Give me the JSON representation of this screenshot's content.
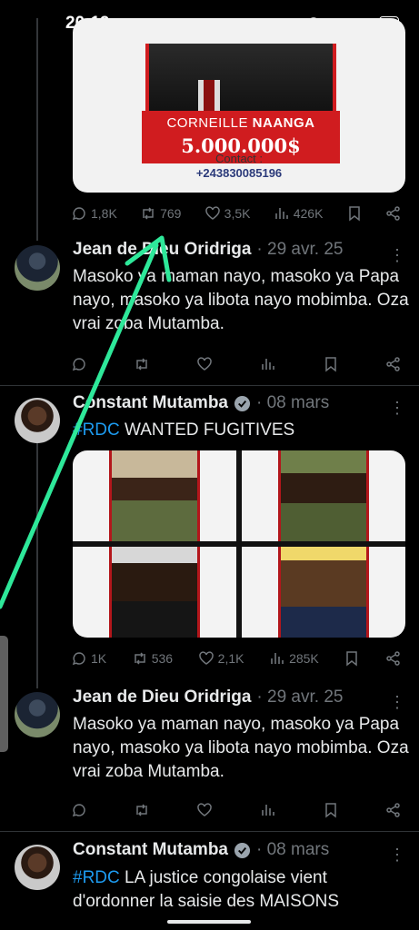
{
  "status_bar": {
    "time": "20:19",
    "left_icons": [
      "℘",
      "P",
      "⊟",
      "•"
    ],
    "right_icons": [
      "headphones-icon",
      "vibrate-icon",
      "hotspot-icon",
      "4G signal",
      "wifi-icon"
    ],
    "battery": "36"
  },
  "post1": {
    "banner_first": "CORNEILLE ",
    "banner_last": "NAANGA",
    "amount": "5.000.000$",
    "contact_label": "Contact :",
    "contact_phone": "+243830085196",
    "actions": {
      "replies": "1,8K",
      "reposts": "769",
      "likes": "3,5K",
      "views": "426K"
    }
  },
  "reply1": {
    "name": "Jean de Dieu Oridriga",
    "meta": "· 29 avr. 25",
    "text": "Masoko ya maman nayo, masoko ya Papa nayo, masoko ya libota nayo mobimba. Oza vrai zoba Mutamba."
  },
  "post2": {
    "name": "Constant Mutamba",
    "meta": "· 08 mars",
    "hashtag": "#RDC",
    "text": " WANTED FUGITIVES",
    "actions": {
      "replies": "1K",
      "reposts": "536",
      "likes": "2,1K",
      "views": "285K"
    }
  },
  "reply2": {
    "name": "Jean de Dieu Oridriga",
    "meta": "· 29 avr. 25",
    "text": "Masoko ya maman nayo, masoko ya Papa nayo, masoko ya libota nayo mobimba. Oza vrai zoba Mutamba."
  },
  "post3": {
    "name": "Constant Mutamba",
    "meta": "· 08 mars",
    "hashtag": "#RDC",
    "text": " LA justice congolaise vient d'ordonner la saisie des MAISONS"
  },
  "colors": {
    "background": "#000000",
    "text": "#e7e9ea",
    "muted": "#71767b",
    "link": "#1d9bf0",
    "arrow": "#2ee89a",
    "banner_red": "#d01c1f"
  }
}
